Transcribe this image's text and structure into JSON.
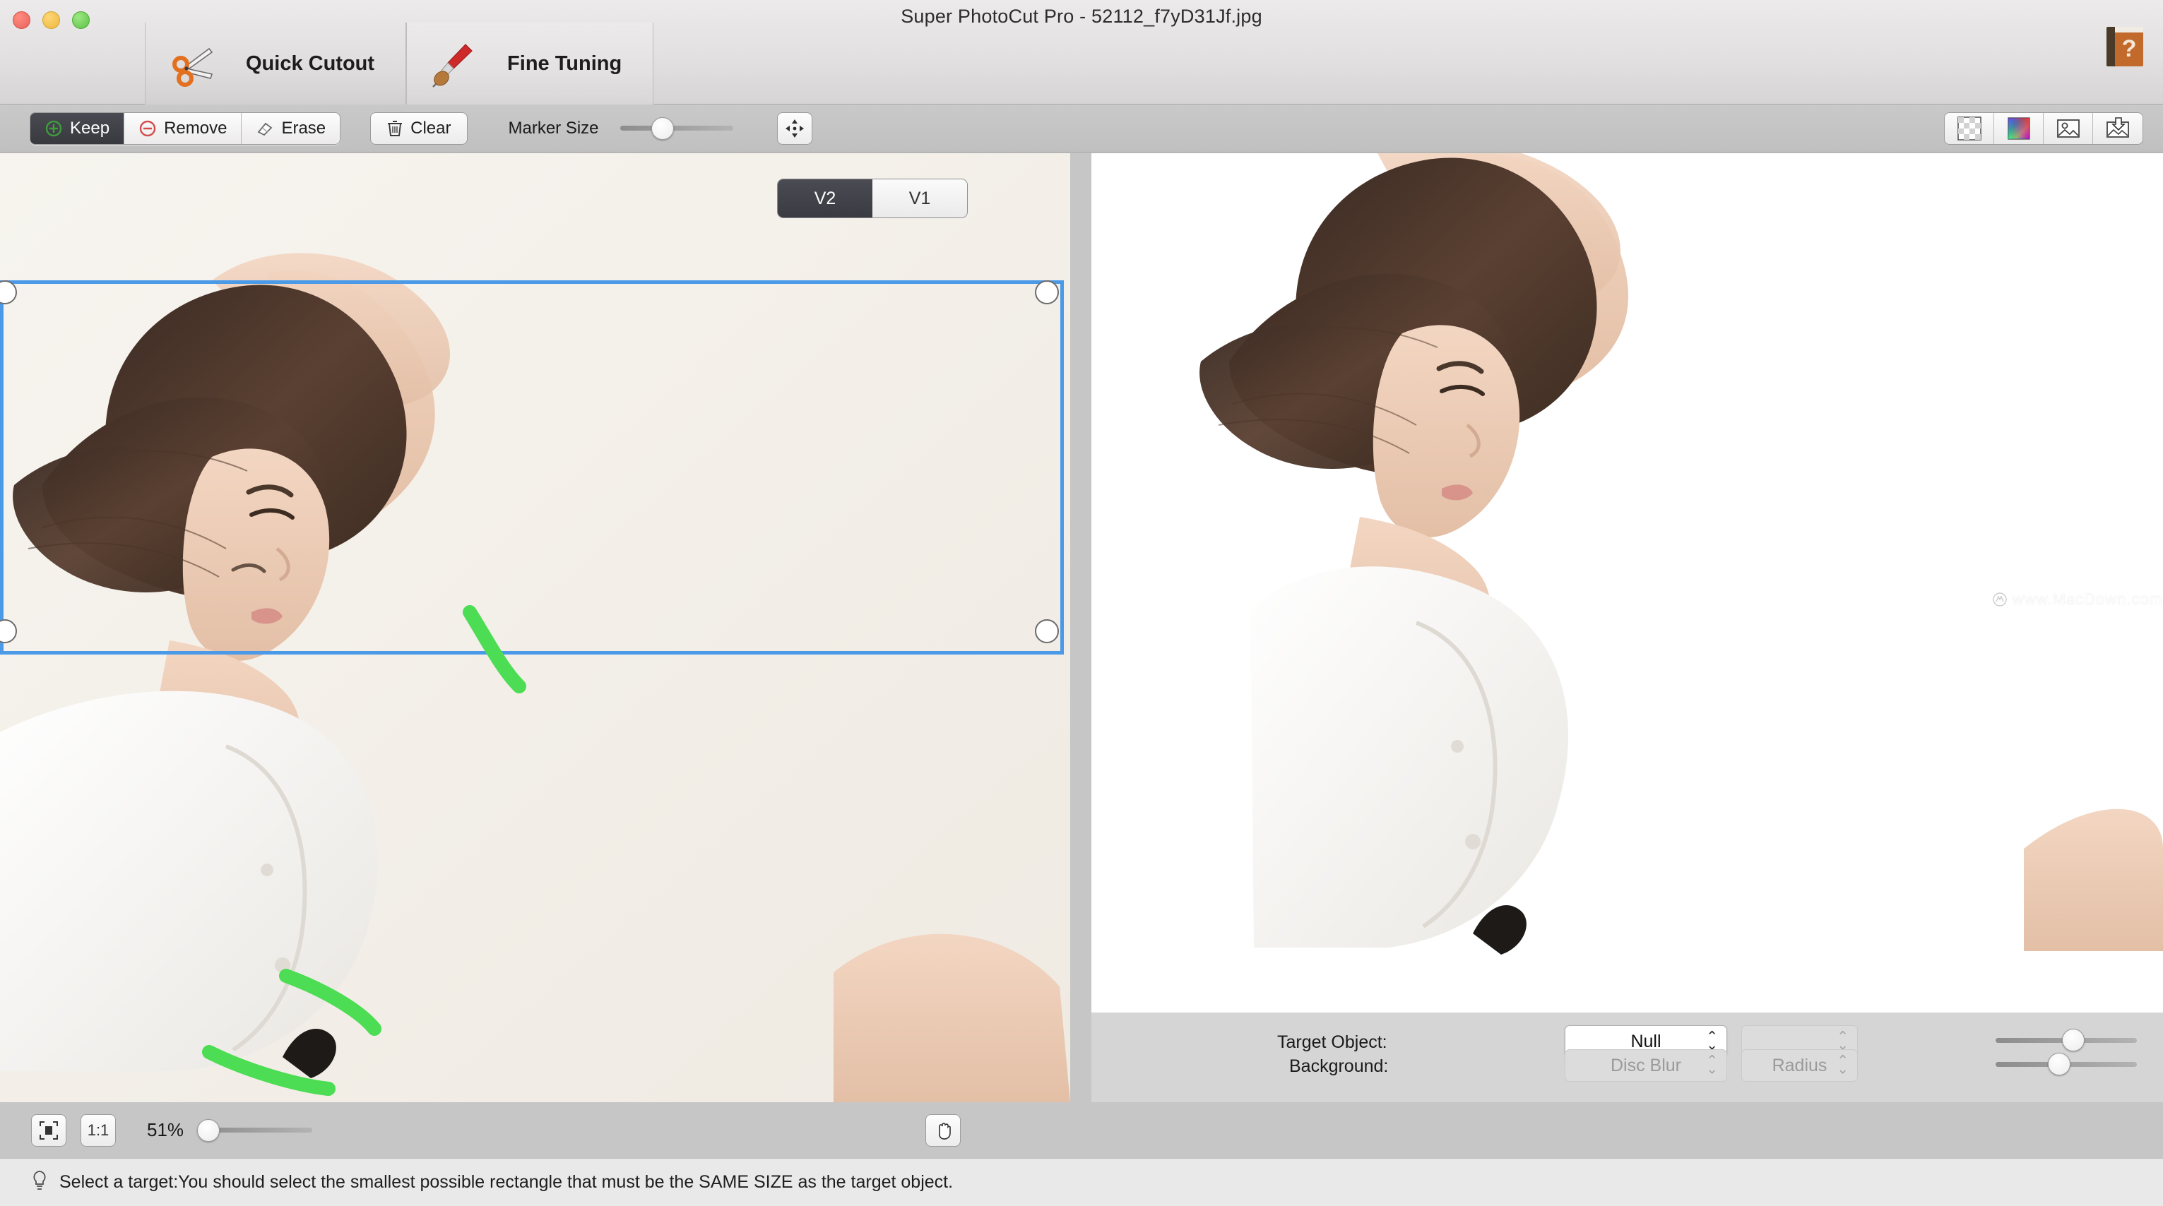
{
  "window": {
    "title": "Super PhotoCut Pro - 52112_f7yD31Jf.jpg",
    "traffic_lights": [
      "close",
      "minimize",
      "zoom"
    ]
  },
  "tabs": [
    {
      "label": "Quick Cutout",
      "icon": "scissors-icon",
      "active": true
    },
    {
      "label": "Fine Tuning",
      "icon": "paintbrush-icon",
      "active": false
    }
  ],
  "help": {
    "icon": "help-book-icon",
    "label": "?"
  },
  "toolbar": {
    "mode_segments": [
      {
        "label": "Keep",
        "icon": "plus-circle-icon",
        "active": true
      },
      {
        "label": "Remove",
        "icon": "minus-circle-icon",
        "active": false
      },
      {
        "label": "Erase",
        "icon": "eraser-icon",
        "active": false
      }
    ],
    "clear": {
      "label": "Clear",
      "icon": "trash-icon"
    },
    "marker_size": {
      "label": "Marker Size",
      "value": 38,
      "min": 0,
      "max": 100
    },
    "move_tool": {
      "icon": "move-arrows-icon"
    },
    "right_tools": [
      {
        "icon": "transparency-checker-icon"
      },
      {
        "icon": "color-wheel-icon"
      },
      {
        "icon": "image-icon"
      },
      {
        "icon": "save-image-icon"
      }
    ]
  },
  "preview": {
    "version_toggle": [
      {
        "label": "V2",
        "active": true
      },
      {
        "label": "V1",
        "active": false
      }
    ],
    "watermark": "www.MacDown.com"
  },
  "options": {
    "target_object": {
      "label": "Target Object:",
      "value": "Null",
      "secondary_value": "",
      "secondary_disabled": true,
      "slider_value": 55
    },
    "background": {
      "label": "Background:",
      "value": "Disc Blur",
      "disabled": true,
      "secondary_value": "Radius",
      "secondary_disabled": true,
      "slider_value": 45
    }
  },
  "zoom": {
    "fit_icon": "fit-to-screen-icon",
    "actual_size_label": "1:1",
    "percent": "51%",
    "value": 8,
    "pan_icon": "hand-pan-icon"
  },
  "status": {
    "icon": "lightbulb-icon",
    "text": "Select a target:You should select the smallest possible rectangle that must be the SAME SIZE as the target object."
  },
  "colors": {
    "accent_selection": "#4a9ae8",
    "marker_green": "#4cdd54",
    "active_segment": "#3a3a42",
    "toolbar_bg": "#c4c4c4",
    "panel_bg": "#d5d5d5"
  }
}
